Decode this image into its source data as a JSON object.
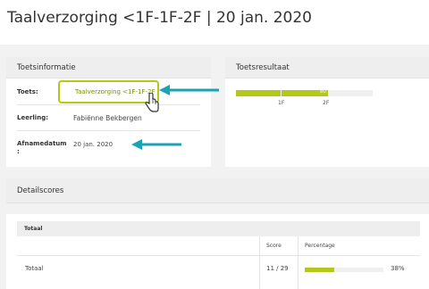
{
  "page": {
    "title": "Taalverzorging <1F-1F-2F | 20 jan. 2020"
  },
  "colors": {
    "accent": "#b4c817",
    "arrow": "#1aa3b5",
    "link": "#7a8c0c"
  },
  "info": {
    "header": "Toetsinformatie",
    "rows": [
      {
        "label": "Toets:",
        "value": "Taalverzorging <1F-1F-2F"
      },
      {
        "label": "Leerling:",
        "value": "Fabiënne Bekbergen"
      },
      {
        "label": "Afnamedatum\n:",
        "value": "20 jan. 2020"
      }
    ]
  },
  "result": {
    "header": "Toetsresultaat",
    "level_value": "80",
    "markers": [
      "1F",
      "2F"
    ]
  },
  "details": {
    "header": "Detailscores",
    "table_title": "Totaal",
    "columns": [
      "Score",
      "Percentage"
    ],
    "rows": [
      {
        "label": "Totaal",
        "score": "11 / 29",
        "percentage_label": "38%",
        "percentage": 0.38
      }
    ]
  }
}
